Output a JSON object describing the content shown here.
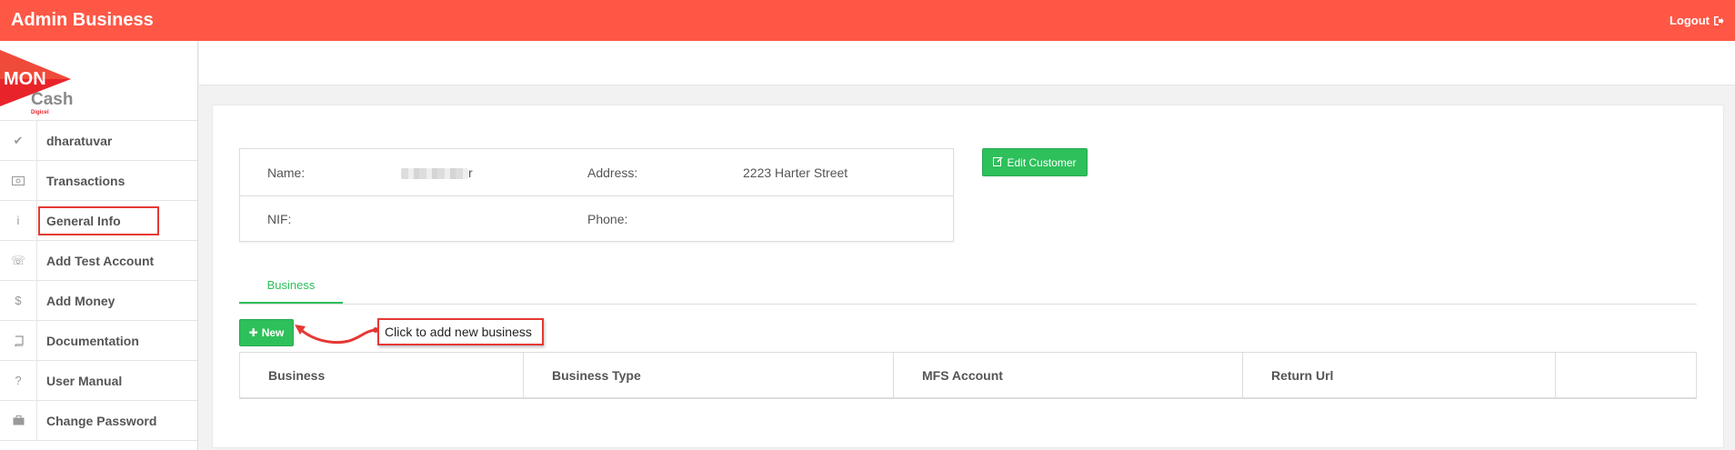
{
  "header": {
    "brand": "Admin Business",
    "logout_label": "Logout"
  },
  "logo": {
    "main": "MON",
    "sub": "Cash",
    "tag": "Digicel"
  },
  "sidebar": {
    "items": [
      {
        "label": "dharatuvar",
        "icon": "check-icon"
      },
      {
        "label": "Transactions",
        "icon": "money-icon"
      },
      {
        "label": "General Info",
        "icon": "info-icon"
      },
      {
        "label": "Add Test Account",
        "icon": "phone-icon"
      },
      {
        "label": "Add Money",
        "icon": "dollar-icon"
      },
      {
        "label": "Documentation",
        "icon": "book-icon"
      },
      {
        "label": "User Manual",
        "icon": "question-icon"
      },
      {
        "label": "Change Password",
        "icon": "briefcase-icon"
      }
    ]
  },
  "customer": {
    "name_label": "Name:",
    "name_value_suffix": "r",
    "address_label": "Address:",
    "address_value": "2223 Harter Street",
    "nif_label": "NIF:",
    "phone_label": "Phone:"
  },
  "actions": {
    "edit_customer": "Edit Customer",
    "new": "New"
  },
  "tabs": {
    "business": "Business"
  },
  "callout": "Click to add new business",
  "table": {
    "columns": [
      "Business",
      "Business Type",
      "MFS Account",
      "Return Url",
      ""
    ]
  },
  "colors": {
    "accent": "#ff5745",
    "green": "#2ec05b",
    "highlight": "#e53935"
  }
}
